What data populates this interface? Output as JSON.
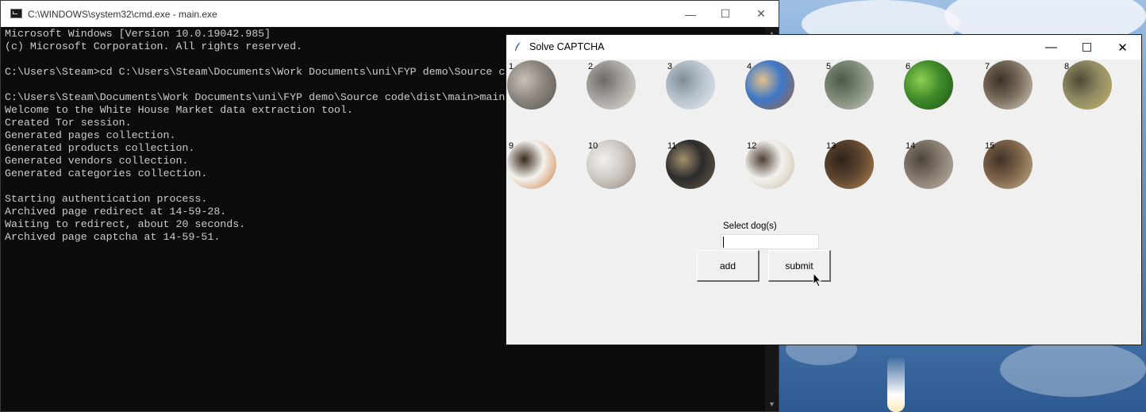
{
  "desktop": {
    "wallpaper": "sky-with-rocket-launch"
  },
  "cmd_window": {
    "title": "C:\\WINDOWS\\system32\\cmd.exe - main.exe",
    "icon": "console-icon",
    "console_text": "Microsoft Windows [Version 10.0.19042.985]\n(c) Microsoft Corporation. All rights reserved.\n\nC:\\Users\\Steam>cd C:\\Users\\Steam\\Documents\\Work Documents\\uni\\FYP demo\\Source code\\dist\\main\n\nC:\\Users\\Steam\\Documents\\Work Documents\\uni\\FYP demo\\Source code\\dist\\main>main\nWelcome to the White House Market data extraction tool.\nCreated Tor session.\nGenerated pages collection.\nGenerated products collection.\nGenerated vendors collection.\nGenerated categories collection.\n\nStarting authentication process.\nArchived page redirect at 14-59-28.\nWaiting to redirect, about 20 seconds.\nArchived page captcha at 14-59-51.",
    "controls": {
      "minimize": "—",
      "maximize": "☐",
      "close": "✕"
    }
  },
  "captcha_window": {
    "title": "Solve CAPTCHA",
    "icon": "feather-icon",
    "controls": {
      "minimize": "—",
      "maximize": "☐",
      "close": "✕"
    },
    "tiles": [
      {
        "number": "1",
        "subject": "cat",
        "colors": [
          "#8c8680",
          "#5a534c",
          "#c9c2b8"
        ]
      },
      {
        "number": "2",
        "subject": "building",
        "colors": [
          "#a7a49f",
          "#e2ddd6",
          "#6d6a66"
        ]
      },
      {
        "number": "3",
        "subject": "winter-trees",
        "colors": [
          "#b7c2cc",
          "#e8edf0",
          "#7f8c96"
        ]
      },
      {
        "number": "4",
        "subject": "dog",
        "colors": [
          "#3d77c8",
          "#a7673a",
          "#e3c08a"
        ]
      },
      {
        "number": "5",
        "subject": "street",
        "colors": [
          "#7f8a78",
          "#c4c9be",
          "#4b5a45"
        ]
      },
      {
        "number": "6",
        "subject": "frog",
        "colors": [
          "#3f8b2b",
          "#1f4f14",
          "#8fcf52"
        ]
      },
      {
        "number": "7",
        "subject": "horse",
        "colors": [
          "#7a6b5a",
          "#d8d2c4",
          "#3b3025"
        ]
      },
      {
        "number": "8",
        "subject": "bus",
        "colors": [
          "#8f8a63",
          "#c9b46a",
          "#4d4a36"
        ]
      },
      {
        "number": "9",
        "subject": "dog",
        "colors": [
          "#f4f2ee",
          "#c77b3a",
          "#3a2a1c"
        ]
      },
      {
        "number": "10",
        "subject": "snowy-branches",
        "colors": [
          "#cfcac4",
          "#8f857c",
          "#f2f0ec"
        ]
      },
      {
        "number": "11",
        "subject": "building",
        "colors": [
          "#2b2b2b",
          "#6e5e49",
          "#a4906d"
        ]
      },
      {
        "number": "12",
        "subject": "dog",
        "colors": [
          "#f3f1ed",
          "#c9b9a5",
          "#4d4036"
        ]
      },
      {
        "number": "13",
        "subject": "dog",
        "colors": [
          "#5c4430",
          "#b3874e",
          "#2e2218"
        ]
      },
      {
        "number": "14",
        "subject": "reptile",
        "colors": [
          "#857a6f",
          "#c2b7a8",
          "#4b433b"
        ]
      },
      {
        "number": "15",
        "subject": "building",
        "colors": [
          "#7d6248",
          "#c7b393",
          "#3f3227"
        ]
      }
    ],
    "prompt_label": "Select dog(s)",
    "entry_value": "",
    "add_button": "add",
    "submit_button": "submit"
  }
}
